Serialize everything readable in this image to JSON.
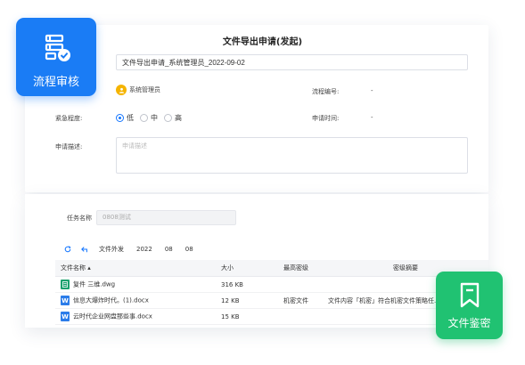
{
  "form": {
    "title": "文件导出申请(发起)",
    "subject_value": "文件导出申请_系统管理员_2022-09-02",
    "applicant": "系统管理员",
    "flow_number_label": "流程编号:",
    "flow_number_value": "-",
    "urgency_label": "紧急程度:",
    "urgency_options": [
      "低",
      "中",
      "高"
    ],
    "urgency_selected": "低",
    "apply_time_label": "申请时间:",
    "apply_time_value": "-",
    "description_label": "申请描述:",
    "description_placeholder": "申请描述"
  },
  "task": {
    "name_label": "任务名称",
    "name_value": "0808测试"
  },
  "toolbar": {
    "path": [
      "文件外发",
      "2022",
      "08",
      "08"
    ]
  },
  "table": {
    "headers": [
      "文件名称",
      "大小",
      "最高密级",
      "密级摘要"
    ],
    "rows": [
      {
        "icon": "dwg",
        "name": "复件 三维.dwg",
        "size": "316 KB",
        "level": "",
        "summary": ""
      },
      {
        "icon": "doc",
        "name": "信息大爆炸时代。(1).docx",
        "size": "12 KB",
        "level": "机密文件",
        "summary": "文件内容「机密」符合机密文件策略任..."
      },
      {
        "icon": "doc",
        "name": "云时代企业网盘那些事.docx",
        "size": "15 KB",
        "level": "",
        "summary": ""
      }
    ]
  },
  "badges": {
    "workflow_review": "流程审核",
    "file_classification": "文件鉴密"
  },
  "colors": {
    "primary": "#1a7cf5",
    "success": "#20c272",
    "avatar": "#f5b400"
  }
}
